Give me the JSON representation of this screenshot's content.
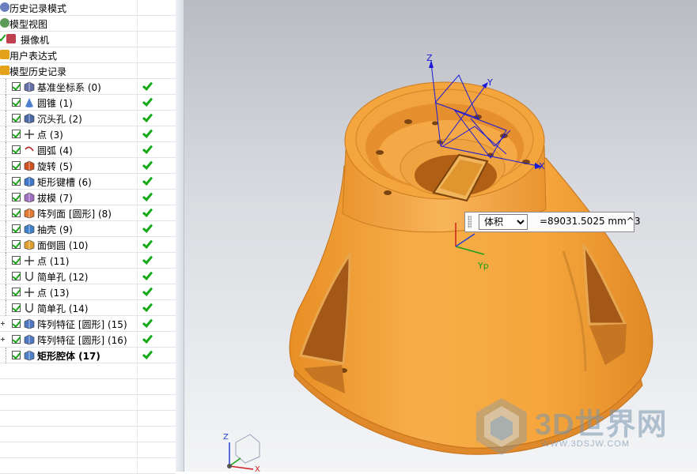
{
  "part_navigator": {
    "top_items": [
      {
        "label": "历史记录模式"
      },
      {
        "label": "模型视图"
      },
      {
        "label": "摄像机"
      },
      {
        "label": "用户表达式"
      },
      {
        "label": "模型历史记录"
      }
    ],
    "features": [
      {
        "label": "基准坐标系 (0)",
        "icon": "datum-csys-icon",
        "bold": false,
        "expandable": false
      },
      {
        "label": "圆锥 (1)",
        "icon": "cone-icon",
        "bold": false,
        "expandable": false
      },
      {
        "label": "沉头孔 (2)",
        "icon": "counterbore-hole-icon",
        "bold": false,
        "expandable": false
      },
      {
        "label": "点 (3)",
        "icon": "point-icon",
        "bold": false,
        "expandable": false
      },
      {
        "label": "圆弧 (4)",
        "icon": "arc-icon",
        "bold": false,
        "expandable": false
      },
      {
        "label": "旋转 (5)",
        "icon": "revolve-icon",
        "bold": false,
        "expandable": false
      },
      {
        "label": "矩形键槽 (6)",
        "icon": "rectangular-slot-icon",
        "bold": false,
        "expandable": false
      },
      {
        "label": "拔模 (7)",
        "icon": "draft-icon",
        "bold": false,
        "expandable": false
      },
      {
        "label": "阵列面 [圆形] (8)",
        "icon": "pattern-face-icon",
        "bold": false,
        "expandable": false
      },
      {
        "label": "抽壳 (9)",
        "icon": "shell-icon",
        "bold": false,
        "expandable": false
      },
      {
        "label": "面倒圆 (10)",
        "icon": "face-blend-icon",
        "bold": false,
        "expandable": false
      },
      {
        "label": "点 (11)",
        "icon": "point-icon",
        "bold": false,
        "expandable": false
      },
      {
        "label": "简单孔 (12)",
        "icon": "simple-hole-icon",
        "bold": false,
        "expandable": false
      },
      {
        "label": "点 (13)",
        "icon": "point-icon",
        "bold": false,
        "expandable": false
      },
      {
        "label": "简单孔 (14)",
        "icon": "simple-hole-icon",
        "bold": false,
        "expandable": false
      },
      {
        "label": "阵列特征 [圆形] (15)",
        "icon": "pattern-feature-icon",
        "bold": false,
        "expandable": true
      },
      {
        "label": "阵列特征 [圆形] (16)",
        "icon": "pattern-feature-icon",
        "bold": false,
        "expandable": true
      },
      {
        "label": "矩形腔体 (17)",
        "icon": "rectangular-pocket-icon",
        "bold": true,
        "expandable": false
      }
    ]
  },
  "viewport": {
    "csys_labels": {
      "z": "Z",
      "y": "Y",
      "x": "X"
    },
    "wcs_label": "Yp",
    "triad_labels": {
      "z": "Z",
      "x": "X"
    },
    "model_color": "#f5a33c"
  },
  "measure": {
    "type_options": [
      "体积"
    ],
    "value": "=89031.5025 mm^3"
  },
  "watermark": {
    "logo": "3D世界网",
    "url": "WWW.3DSJW.COM"
  }
}
